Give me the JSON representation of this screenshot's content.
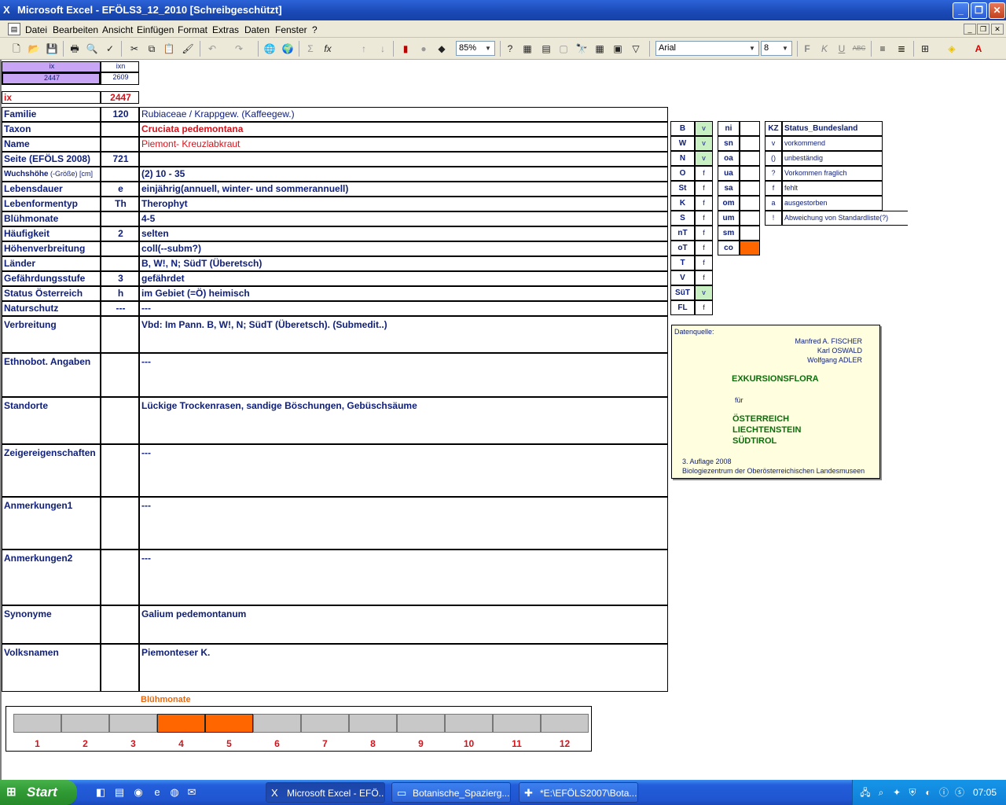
{
  "window": {
    "title": "Microsoft Excel - EFÖLS3_12_2010  [Schreibgeschützt]",
    "app_icon": "excel-icon"
  },
  "menu": {
    "items": [
      "Datei",
      "Bearbeiten",
      "Ansicht",
      "Einfügen",
      "Format",
      "Extras",
      "Daten",
      "Fenster",
      "?"
    ]
  },
  "toolbar": {
    "zoom": "85%",
    "font_name": "Arial",
    "font_size": "8",
    "bold": "F",
    "italic": "K",
    "underline": "U",
    "strike": "ABC",
    "sum": "Σ",
    "fx": "fx"
  },
  "index": {
    "ix_header": "ix",
    "ixn_header": "ixn",
    "ix_value": "2447",
    "ixn_value": "2609",
    "ix_label": "ix",
    "ix_big": "2447"
  },
  "rows": [
    {
      "label": "Familie",
      "code": "120",
      "text": "Rubiaceae  /  Krappgew. (Kaffeegew.)"
    },
    {
      "label": "Taxon",
      "code": "",
      "text": "Cruciata pedemontana"
    },
    {
      "label": "Name",
      "code": "",
      "text": "Piemont- Kreuzlabkraut"
    },
    {
      "label": "Seite (EFÖLS 2008)",
      "code": "721",
      "text": ""
    },
    {
      "label": "Wuchshöhe",
      "label_suffix": " (-Größe) [cm]",
      "code": "",
      "text": "(2) 10 - 35"
    },
    {
      "label": "Lebensdauer",
      "code": "e",
      "text": "einjährig(annuell, winter- und sommerannuell)"
    },
    {
      "label": "Lebenformentyp",
      "code": "Th",
      "text": "Therophyt"
    },
    {
      "label": "Blühmonate",
      "code": "",
      "text": "4-5"
    },
    {
      "label": "Häufigkeit",
      "code": "2",
      "text": "selten"
    },
    {
      "label": "Höhenverbreitung",
      "code": "",
      "text": "coll(--subm?)"
    },
    {
      "label": "Länder",
      "code": "",
      "text": "B, W!, N; SüdT (Überetsch)"
    },
    {
      "label": "Gefährdungsstufe",
      "code": "3",
      "text": "gefährdet"
    },
    {
      "label": "Status Österreich",
      "code": "h",
      "text": "im Gebiet (=Ö) heimisch"
    },
    {
      "label": "Naturschutz",
      "code": "---",
      "text": "---"
    },
    {
      "label": "Verbreitung",
      "code": "",
      "text": "Vbd:  Im Pann. B, W!, N; SüdT (Überetsch). (Submedit..)"
    },
    {
      "label": "Ethnobot. Angaben",
      "code": "",
      "text": "---"
    },
    {
      "label": "Standorte",
      "code": "",
      "text": "Lückige Trockenrasen, sandige Böschungen, Gebüschsäume"
    },
    {
      "label": "Zeigereigenschaften",
      "code": "",
      "text": "---"
    },
    {
      "label": "Anmerkungen1",
      "code": "",
      "text": "---"
    },
    {
      "label": "Anmerkungen2",
      "code": "",
      "text": "---"
    },
    {
      "label": "Synonyme",
      "code": "",
      "text": "Galium pedemontanum"
    },
    {
      "label": "Volksnamen",
      "code": "",
      "text": "Piemonteser K."
    }
  ],
  "states": [
    {
      "code": "B",
      "v": "v",
      "green": true
    },
    {
      "code": "W",
      "v": "v",
      "green": true
    },
    {
      "code": "N",
      "v": "v",
      "green": true
    },
    {
      "code": "O",
      "v": "f",
      "green": false
    },
    {
      "code": "St",
      "v": "f",
      "green": false
    },
    {
      "code": "K",
      "v": "f",
      "green": false
    },
    {
      "code": "S",
      "v": "f",
      "green": false
    },
    {
      "code": "nT",
      "v": "f",
      "green": false
    },
    {
      "code": "oT",
      "v": "f",
      "green": false
    },
    {
      "code": "T",
      "v": "f",
      "green": false
    },
    {
      "code": "V",
      "v": "f",
      "green": false
    },
    {
      "code": "SüT",
      "v": "v",
      "green": true
    },
    {
      "code": "FL",
      "v": "f",
      "green": false
    }
  ],
  "altitudes": [
    {
      "code": "ni",
      "on": false
    },
    {
      "code": "sn",
      "on": false
    },
    {
      "code": "oa",
      "on": false
    },
    {
      "code": "ua",
      "on": false
    },
    {
      "code": "sa",
      "on": false
    },
    {
      "code": "om",
      "on": false
    },
    {
      "code": "um",
      "on": false
    },
    {
      "code": "sm",
      "on": false
    },
    {
      "code": "co",
      "on": true
    }
  ],
  "legend": {
    "header_kz": "KZ",
    "header_status": "Status_Bundesland",
    "items": [
      {
        "kz": "v",
        "text": "vorkommend"
      },
      {
        "kz": "()",
        "text": "unbeständig"
      },
      {
        "kz": "?",
        "text": "Vorkommen fraglich"
      },
      {
        "kz": "f",
        "text": "fehlt"
      },
      {
        "kz": "a",
        "text": "ausgestorben"
      },
      {
        "kz": "!",
        "text": "Abweichung von Standardliste(?)"
      }
    ]
  },
  "source": {
    "label": "Datenquelle:",
    "authors": [
      "Manfred A. FISCHER",
      "Karl OSWALD",
      "Wolfgang ADLER"
    ],
    "title": "EXKURSIONSFLORA",
    "fuer": "für",
    "countries": [
      "ÖSTERREICH",
      "LIECHTENSTEIN",
      "SÜDTIROL"
    ],
    "edition": "3. Auflage 2008",
    "publisher": "Biologiezentrum der Oberösterreichischen Landesmuseen"
  },
  "bloom": {
    "title": "Blühmonate",
    "months": [
      "1",
      "2",
      "3",
      "4",
      "5",
      "6",
      "7",
      "8",
      "9",
      "10",
      "11",
      "12"
    ],
    "active": [
      4,
      5
    ]
  },
  "taskbar": {
    "start": "Start",
    "tasks": [
      {
        "label": "Microsoft Excel - EFÖ...",
        "icon": "excel-icon",
        "active": true
      },
      {
        "label": "Botanische_Spazierg...",
        "icon": "folder-icon",
        "active": false
      },
      {
        "label": "*E:\\EFÖLS2007\\Bota...",
        "icon": "app-icon",
        "active": false
      }
    ],
    "clock": "07:05"
  },
  "colors": {
    "label_text": "#10207a",
    "taxon_red": "#d4141c",
    "highlight_orange": "#ff6600",
    "state_green": "#c9f0c2",
    "ix_purple": "#c9a6f5",
    "source_bg": "#ffffe0"
  }
}
